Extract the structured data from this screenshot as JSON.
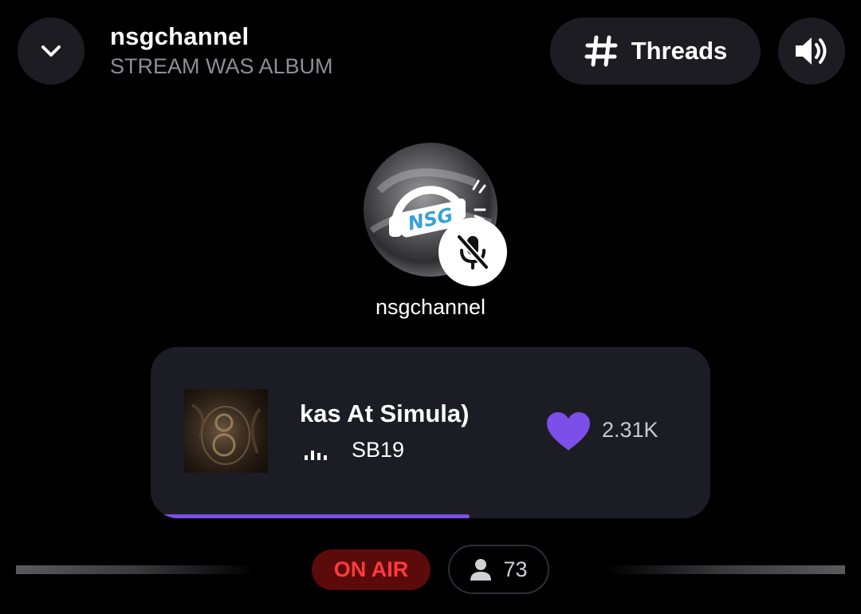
{
  "header": {
    "title": "nsgchannel",
    "subtitle": "STREAM WAS ALBUM",
    "threads_label": "Threads"
  },
  "host": {
    "name": "nsgchannel",
    "avatar_text": "NSG",
    "muted": true
  },
  "now_playing": {
    "title": "kas At Simula)",
    "artist": "SB19",
    "likes": "2.31K",
    "progress": 0.57
  },
  "status": {
    "on_air_label": "ON AIR",
    "listeners": "73"
  },
  "icons": {
    "back": "chevron-down-icon",
    "threads": "hash-icon",
    "sound": "speaker-icon",
    "mute": "mic-off-icon",
    "like": "heart-icon",
    "listeners": "person-icon"
  },
  "colors": {
    "background": "#000000",
    "surface": "#1c1c22",
    "accent": "#7b4fe8",
    "on_air_bg": "#5c0a0a",
    "on_air_text": "#ff3b3b",
    "avatar_brand": "#3aa0d8"
  }
}
